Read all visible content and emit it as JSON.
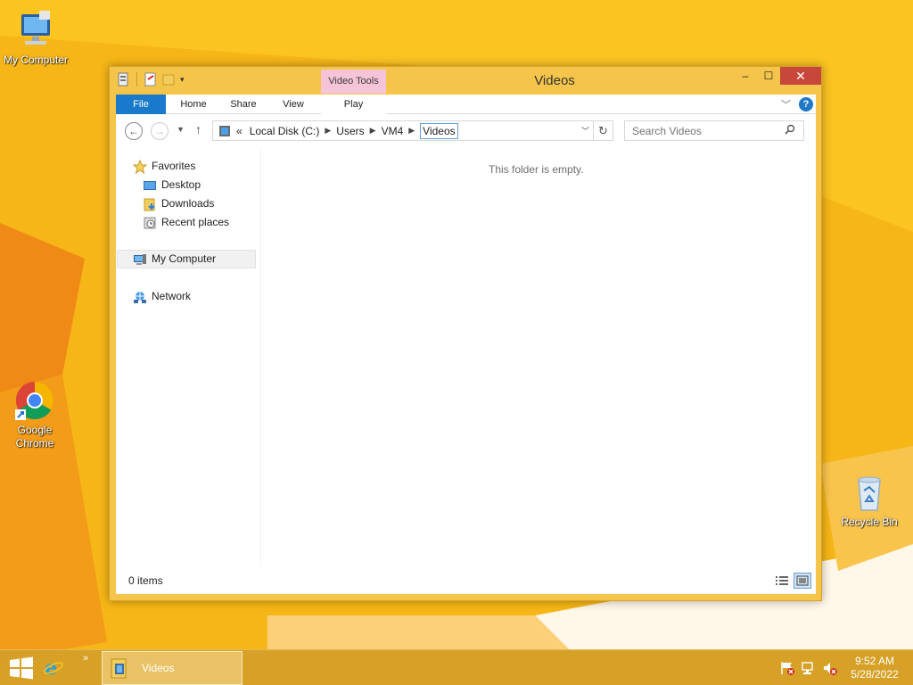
{
  "desktop": {
    "icons": [
      {
        "label": "My Computer"
      },
      {
        "label": "Google Chrome"
      },
      {
        "label": "Recycle Bin"
      }
    ]
  },
  "window": {
    "title": "Videos",
    "context_tab_group": "Video Tools",
    "ribbon_tabs": [
      "File",
      "Home",
      "Share",
      "View",
      "Play"
    ],
    "controls": {
      "minimize": "–",
      "maximize": "☐",
      "close": "✕"
    }
  },
  "address": {
    "overflow": "«",
    "segments": [
      "Local Disk (C:)",
      "Users",
      "VM4",
      "Videos"
    ]
  },
  "search": {
    "placeholder": "Search Videos"
  },
  "nav_pane": {
    "favorites": "Favorites",
    "favorite_items": [
      "Desktop",
      "Downloads",
      "Recent places"
    ],
    "computer": "My Computer",
    "network": "Network"
  },
  "main": {
    "empty_message": "This folder is empty."
  },
  "status": {
    "items": "0 items"
  },
  "taskbar": {
    "more": "»",
    "active_item": "Videos",
    "time": "9:52 AM",
    "date": "5/28/2022"
  },
  "colors": {
    "accent": "#1979ca",
    "desktop": "#f5b31a",
    "context_tab": "#f6c4d8",
    "close": "#c7473a"
  }
}
